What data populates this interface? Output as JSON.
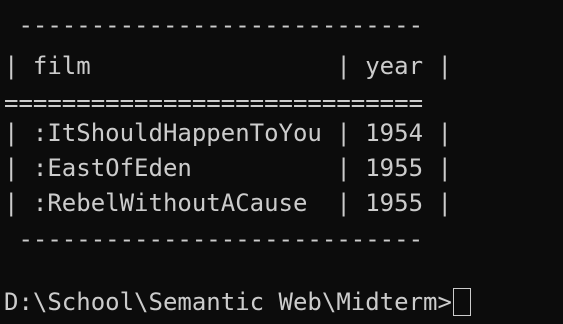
{
  "output": {
    "border_top": " ----------------------------",
    "header_row": "| film                 | year |",
    "separator": "=============================",
    "rows": [
      "| :ItShouldHappenToYou | 1954 |",
      "| :EastOfEden          | 1955 |",
      "| :RebelWithoutACause  | 1955 |"
    ],
    "border_bottom": " ----------------------------"
  },
  "prompt": {
    "path": "D:\\School\\Semantic Web\\Midterm>"
  },
  "colors": {
    "background": "#0c0c0c",
    "text": "#cccccc"
  }
}
